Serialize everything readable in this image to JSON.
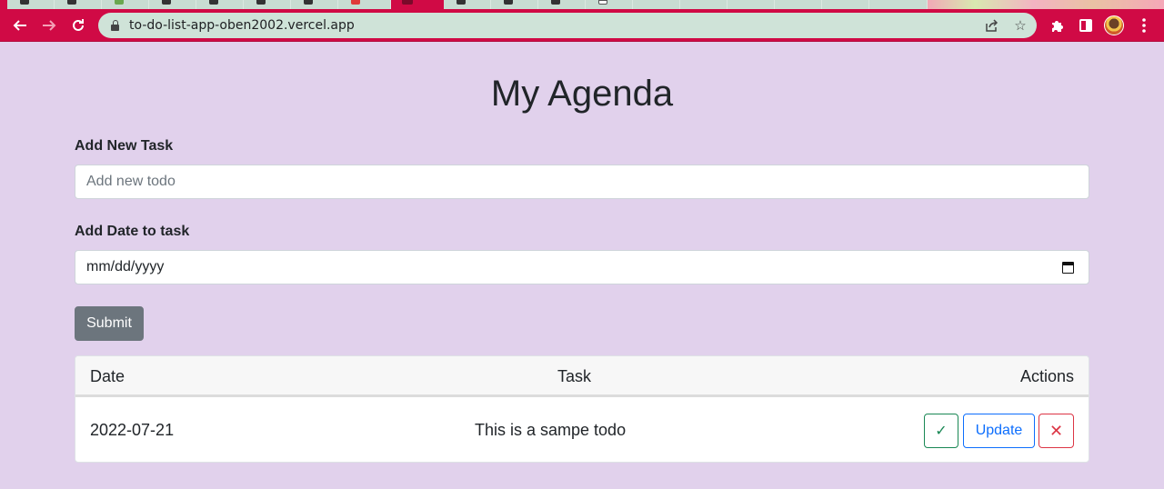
{
  "browser": {
    "url": "to-do-list-app-oben2002.vercel.app",
    "accent_color": "#d00a45",
    "omnibox_color": "#cfe3d8"
  },
  "page": {
    "title": "My Agenda",
    "background": "#e1d1ec"
  },
  "form": {
    "task_label": "Add New Task",
    "task_placeholder": "Add new todo",
    "task_value": "",
    "date_label": "Add Date to task",
    "date_value": "mm/dd/yyyy",
    "submit_label": "Submit"
  },
  "table": {
    "headers": {
      "date": "Date",
      "task": "Task",
      "actions": "Actions"
    },
    "rows": [
      {
        "date": "2022-07-21",
        "task": "This is a sampe todo",
        "done_icon": "✓",
        "update_label": "Update",
        "delete_icon": "✕"
      }
    ]
  }
}
